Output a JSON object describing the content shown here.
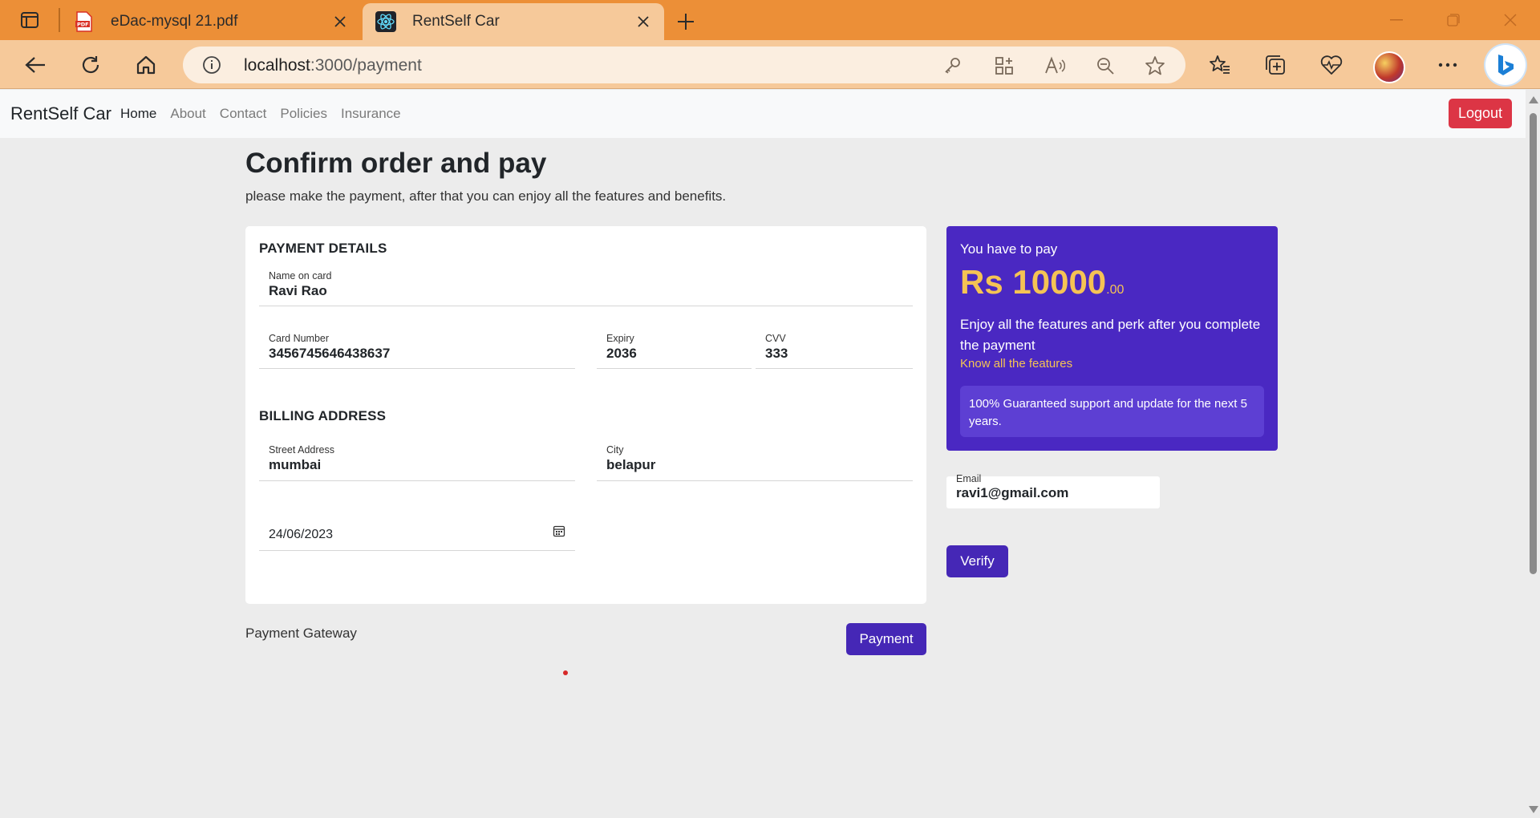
{
  "browser": {
    "tabs": [
      {
        "title": "eDac-mysql 21.pdf",
        "favicon": "pdf-icon",
        "active": false
      },
      {
        "title": "RentSelf Car",
        "favicon": "react-icon",
        "active": true
      }
    ],
    "url_host": "localhost",
    "url_path": ":3000/payment",
    "accent": "#ec8f37"
  },
  "navbar": {
    "brand": "RentSelf Car",
    "links": [
      "Home",
      "About",
      "Contact",
      "Policies",
      "Insurance"
    ],
    "active_link": "Home",
    "logout_label": "Logout"
  },
  "page": {
    "title": "Confirm order and pay",
    "subtitle": "please make the payment, after that you can enjoy all the features and benefits."
  },
  "payment_details": {
    "heading": "PAYMENT DETAILS",
    "name_label": "Name on card",
    "name_value": "Ravi Rao",
    "card_label": "Card Number",
    "card_value": "3456745646438637",
    "expiry_label": "Expiry",
    "expiry_value": "2036",
    "cvv_label": "CVV",
    "cvv_value": "333"
  },
  "billing": {
    "heading": "BILLING ADDRESS",
    "street_label": "Street Address",
    "street_value": "mumbai",
    "city_label": "City",
    "city_value": "belapur",
    "date_value": "24/06/2023"
  },
  "gateway": {
    "label": "Payment Gateway",
    "button": "Payment"
  },
  "summary": {
    "pay_text": "You have to pay",
    "currency": "Rs",
    "amount": "10000",
    "cents": ".00",
    "perk_text": "Enjoy all the features and perk after you complete the payment",
    "features_link": "Know all the features",
    "guarantee": "100% Guaranteed support and update for the next 5 years.",
    "panel_color": "#4a28c2",
    "amount_color": "#f5c354"
  },
  "verify": {
    "email_label": "Email",
    "email_value": "ravi1@gmail.com",
    "button": "Verify"
  }
}
